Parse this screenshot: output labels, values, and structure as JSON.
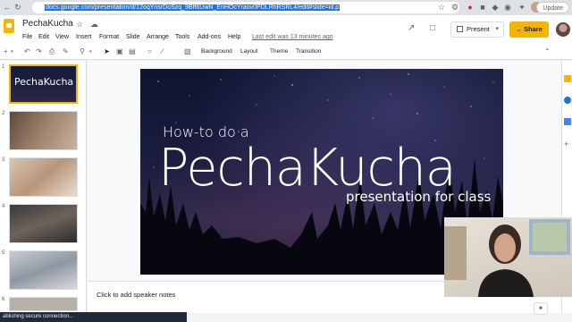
{
  "browser": {
    "url": "docs.google.com/presentation/d/12oqYnsrDoSzq_9Bff6UwN_EnHOcYraov0PDLRhRSRL4/edit#slide=id.p",
    "update_label": "Update"
  },
  "header": {
    "title": "PechaKucha",
    "menus": [
      "File",
      "Edit",
      "View",
      "Insert",
      "Format",
      "Slide",
      "Arrange",
      "Tools",
      "Add-ons",
      "Help"
    ],
    "last_edit": "Last edit was 13 minutes ago",
    "present_label": "Present",
    "share_label": "Share"
  },
  "toolbar": {
    "background_label": "Background",
    "layout_label": "Layout",
    "theme_label": "Theme",
    "transition_label": "Transition"
  },
  "filmstrip": {
    "slide_numbers": [
      "1",
      "2",
      "3",
      "4",
      "5",
      "6"
    ],
    "thumb1_title": "PechaKucha"
  },
  "slide": {
    "kicker": "How-to do a",
    "title": "PechaKucha",
    "subtitle": "presentation for class"
  },
  "notes": {
    "placeholder": "Click to add speaker notes"
  },
  "status": {
    "text": "ablishing secure connection..."
  },
  "colors": {
    "accent": "#f4b400",
    "selection": "#1a73e8"
  }
}
